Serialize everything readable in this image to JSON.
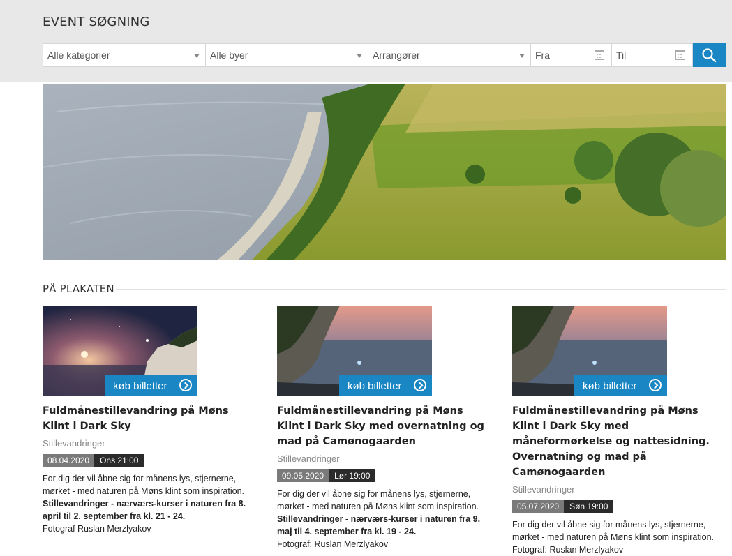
{
  "search": {
    "title": "EVENT SØGNING",
    "category_value": "Alle kategorier",
    "city_value": "Alle byer",
    "organizer_value": "Arrangører",
    "from_placeholder": "Fra",
    "to_placeholder": "Til"
  },
  "section": {
    "title": "PÅ PLAKATEN"
  },
  "cards": [
    {
      "buy_label": "køb billetter",
      "title": "Fuldmånestillevandring på Møns Klint i Dark Sky",
      "category": "Stillevandringer",
      "date": "08.04.2020",
      "time": "Ons 21:00",
      "desc_intro": "For dig der vil åbne sig for månens lys, stjernerne, mørket - med naturen på Møns klint som inspiration.",
      "desc_bold": "Stillevandringer - nærværs-kurser i naturen fra 8. april til 2. september fra kl. 21 - 24.",
      "desc_credit": "Fotograf Ruslan Merzlyakov"
    },
    {
      "buy_label": "køb billetter",
      "title": "Fuldmånestillevandring på Møns Klint i Dark Sky med overnatning og mad på Camønogaarden",
      "category": "Stillevandringer",
      "date": "09.05.2020",
      "time": "Lør 19:00",
      "desc_intro": "For dig der vil åbne sig for månens lys, stjernerne, mørket - med naturen på Møns klint som inspiration.",
      "desc_bold": "Stillevandringer - nærværs-kurser i naturen fra 9. maj til 4. september fra kl. 19 - 24.",
      "desc_credit": "Fotograf: Ruslan Merzlyakov"
    },
    {
      "buy_label": "køb billetter",
      "title": "Fuldmånestillevandring på Møns Klint i Dark Sky med måneformørkelse og nattesidning. Overnatning og mad på Camønogaarden",
      "category": "Stillevandringer",
      "date": "05.07.2020",
      "time": "Søn 19:00",
      "desc_intro": "For dig der vil åbne sig for månens lys, stjernerne, mørket - med naturen på Møns klint som inspiration.",
      "desc_bold": "",
      "desc_credit": "Fotograf: Ruslan Merzlyakov"
    }
  ]
}
